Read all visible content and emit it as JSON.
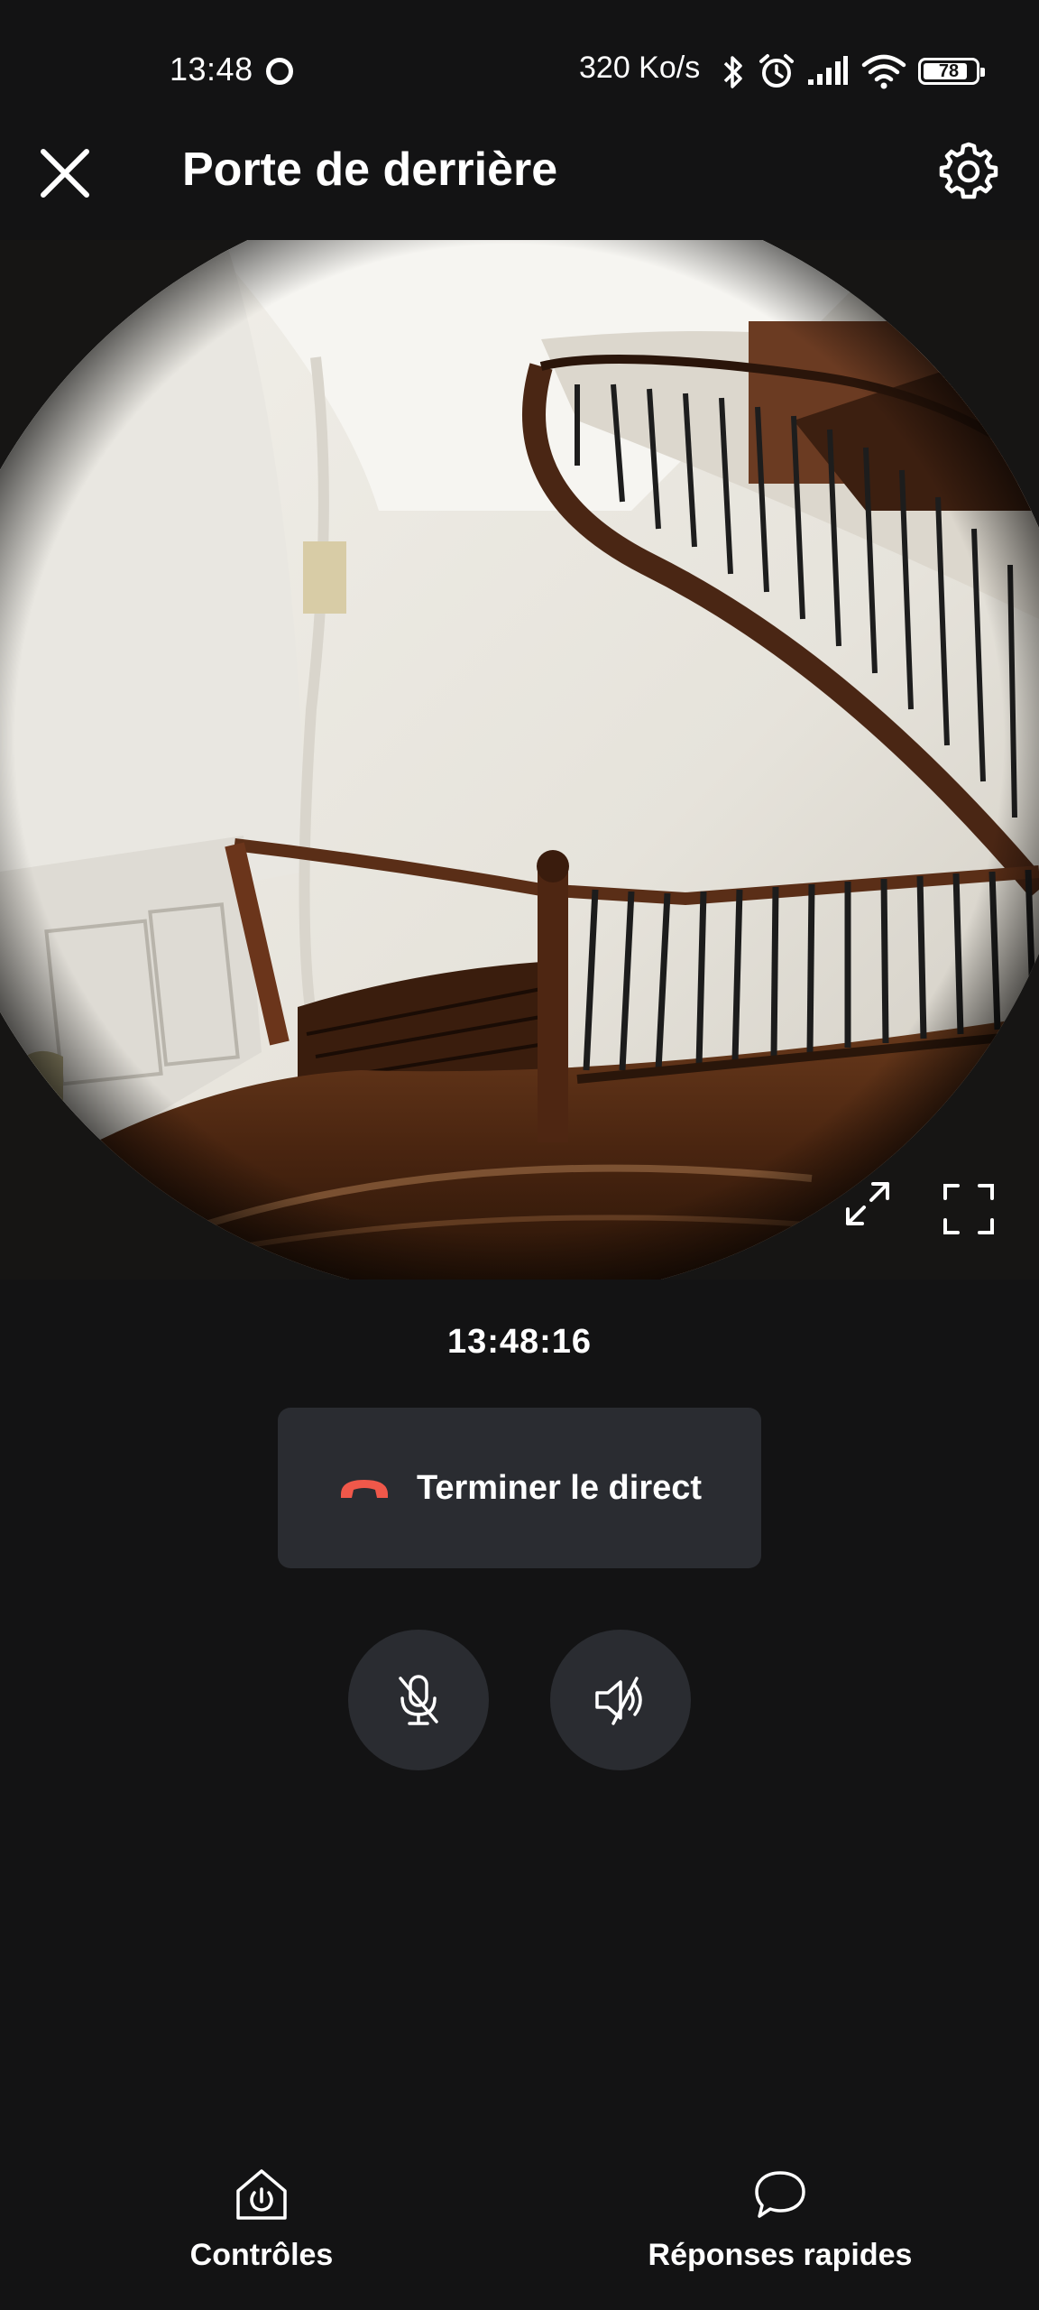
{
  "status_bar": {
    "time": "13:48",
    "network_speed": "320 Ko/s",
    "battery_level": "78",
    "icons": [
      "sync-icon",
      "bluetooth-icon",
      "alarm-icon",
      "signal-icon",
      "wifi-icon",
      "battery-icon"
    ]
  },
  "header": {
    "title": "Porte de derrière",
    "close_icon": "close-icon",
    "settings_icon": "gear-icon"
  },
  "camera": {
    "expand_icon": "expand-icon",
    "fullscreen_icon": "fullscreen-icon"
  },
  "live": {
    "timestamp": "13:48:16",
    "end_live_label": "Terminer le direct",
    "end_live_icon": "hang-up-icon",
    "mic_icon": "mic-muted-icon",
    "speaker_icon": "speaker-muted-icon"
  },
  "bottom_nav": {
    "controls_label": "Contrôles",
    "controls_icon": "home-power-icon",
    "quick_replies_label": "Réponses rapides",
    "quick_replies_icon": "chat-bubble-icon"
  },
  "colors": {
    "background": "#131314",
    "surface": "#2a2c31",
    "hang_up": "#f0584a",
    "text": "#ffffff"
  }
}
